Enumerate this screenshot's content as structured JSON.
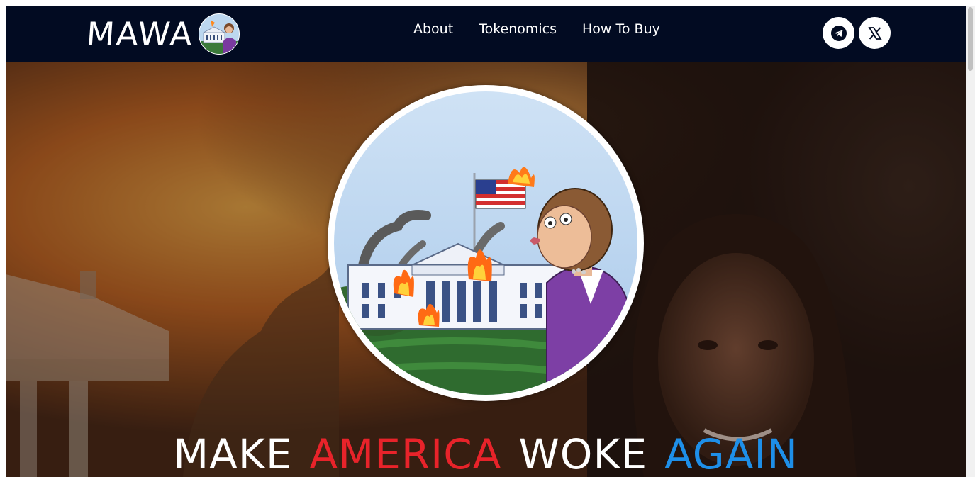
{
  "brand": {
    "name": "MAWA",
    "logo_icon": "white-house-cartoon-logo"
  },
  "nav": {
    "links": [
      {
        "label": "About"
      },
      {
        "label": "Tokenomics"
      },
      {
        "label": "How To Buy"
      }
    ]
  },
  "socials": [
    {
      "icon": "telegram-icon"
    },
    {
      "icon": "x-icon"
    }
  ],
  "hero": {
    "image": "cartoon-burning-white-house-illustration",
    "slogan": {
      "word1": "MAKE",
      "word2": "AMERICA",
      "word3": "WOKE",
      "word4": "AGAIN"
    }
  },
  "colors": {
    "navbar_bg": "#020b22",
    "slogan_red": "#e8232a",
    "slogan_blue": "#1e8fe8",
    "slogan_white": "#ffffff"
  }
}
